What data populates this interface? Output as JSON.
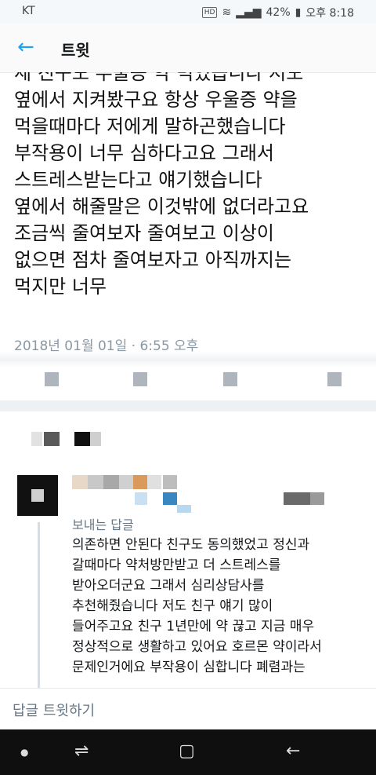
{
  "status_bar": {
    "carrier": "KT",
    "battery": "42%",
    "time": "오후 8:18",
    "hd": "HD"
  },
  "header": {
    "back_icon": "arrow-left-icon",
    "title": "트윗"
  },
  "tweet": {
    "text": "세 친구도 우울증 약 먹었습니다 저도\n옆에서 지켜봤구요 항상 우울증 약을\n먹을때마다 저에게 말하곤했습니다\n부작용이 너무 심하다고요 그래서\n스트레스받는다고 얘기했습니다\n옆에서 해줄말은 이것밖에 없더라고요\n조금씩 줄여보자 줄여보고 이상이\n없으면 점차 줄여보자고 아직까지는\n먹지만 너무",
    "timestamp": "2018년 01월 01일 · 6:55 오후"
  },
  "reply": {
    "replying_label": "보내는 답글",
    "text": "의존하면 안된다 친구도 동의했었고 정신과\n갈때마다 약처방만받고 더 스트레스를\n받아오더군요 그래서 심리상담사를\n추천해줬습니다 저도 친구 얘기 많이\n들어주고요 친구 1년만에 약 끊고 지금 매우\n정상적으로 생활하고 있어요 호르몬 약이라서\n문제인거에요 부작용이 심합니다 폐렴과는"
  },
  "compose": {
    "placeholder": "답글 트윗하기"
  },
  "colors": {
    "accent": "#1da1f2",
    "text": "#14171a",
    "muted": "#657786"
  }
}
